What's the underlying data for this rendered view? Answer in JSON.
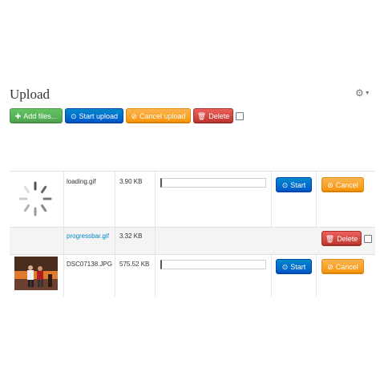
{
  "page": {
    "title": "Upload"
  },
  "header": {
    "settings_icon": "gear-icon"
  },
  "toolbar": {
    "add_label": "Add files...",
    "start_label": "Start upload",
    "cancel_label": "Cancel upload",
    "delete_label": "Delete",
    "select_all_checked": false
  },
  "files": [
    {
      "name": "loading.gif",
      "size": "3.90 KB",
      "preview": "spinner",
      "link": false,
      "progress": 0,
      "start_label": "Start",
      "cancel_label": "Cancel"
    },
    {
      "name": "progressbar.gif",
      "size": "3.32 KB",
      "preview": "none",
      "link": true,
      "delete_label": "Delete",
      "checked": false
    },
    {
      "name": "DSC07138.JPG",
      "size": "575.52 KB",
      "preview": "photo",
      "link": false,
      "progress": 0,
      "start_label": "Start",
      "cancel_label": "Cancel"
    }
  ],
  "colors": {
    "success": "#51a351",
    "primary": "#0055cc",
    "warning": "#f89406",
    "danger": "#bd362f",
    "link": "#0088cc"
  }
}
